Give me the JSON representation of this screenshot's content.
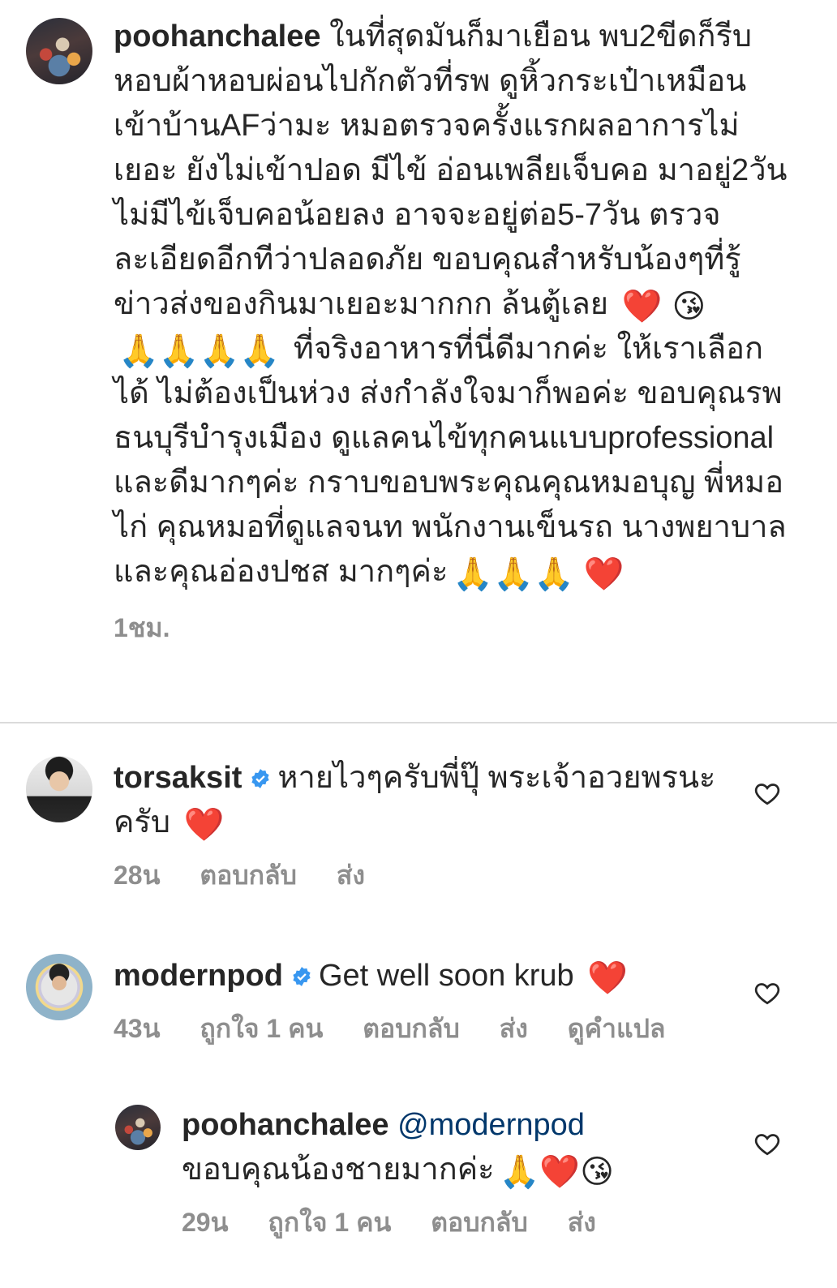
{
  "caption": {
    "username": "poohanchalee",
    "text_line1": "ในที่สุดมันก็มาเยือน พบ2ขีดก็รีบหอบผ้าหอบผ่อนไปกักตัวที่รพ ดูหิ้วกระเป๋าเหมือนเข้าบ้านAFว่ามะ หมอตรวจครั้งแรกผลอาการไม่เยอะ ยังไม่เข้าปอด  มีไข้ อ่อนเพลียเจ็บคอ มาอยู่2วัน ไม่มีไข้เจ็บคอน้อยลง อาจจะอยู่ต่อ5-7วัน ตรวจละเอียดอีกทีว่าปลอดภัย ขอบคุณสำหรับน้องๆที่รู้ข่าวส่งของกินมาเยอะมากกก ล้นตู้เลย",
    "emoji_1": "❤️",
    "emoji_2": "😘",
    "emoji_3": "🙏🙏🙏🙏",
    "text_line2": "ที่จริงอาหารที่นี่ดีมากค่ะ ให้เราเลือกได้ ไม่ต้องเป็นห่วง ส่งกำลังใจมาก็พอค่ะ ขอบคุณรพธนบุรีบำรุงเมือง ดูแลคนไข้ทุกคนแบบprofessional และดีมากๆค่ะ กราบขอบพระคุณคุณหมอบุญ พี่หมอไก่ คุณหมอที่ดูแลจนท พนักงานเข็นรถ นางพยาบาลและคุณอ่องปชส มากๆค่ะ",
    "emoji_4": "🙏🙏🙏",
    "emoji_5": "❤️",
    "time": "1ชม."
  },
  "comments": [
    {
      "username": "torsaksit",
      "verified": true,
      "text": "หายไวๆครับพี่ปุ๊ พระเจ้าอวยพรนะครับ",
      "emoji": "❤️",
      "time": "28น",
      "reply": "ตอบกลับ",
      "send": "ส่ง"
    },
    {
      "username": "modernpod",
      "verified": true,
      "text": "Get well soon krub",
      "emoji": "❤️",
      "time": "43น",
      "likes": "ถูกใจ 1 คน",
      "reply": "ตอบกลับ",
      "send": "ส่ง",
      "translate": "ดูคำแปล"
    }
  ],
  "reply": {
    "username": "poohanchalee",
    "mention": "@modernpod",
    "text": "ขอบคุณน้องชายมากค่ะ",
    "emoji": "🙏❤️😘",
    "time": "29น",
    "likes": "ถูกใจ 1 คน",
    "reply": "ตอบกลับ",
    "send": "ส่ง"
  },
  "colors": {
    "text": "#262626",
    "meta": "#8e8e8e",
    "verified": "#3897f0",
    "mention": "#00376b",
    "divider": "#dbdbdb"
  },
  "icons": {
    "verified": "verified-badge-icon",
    "heart": "heart-outline-icon"
  }
}
